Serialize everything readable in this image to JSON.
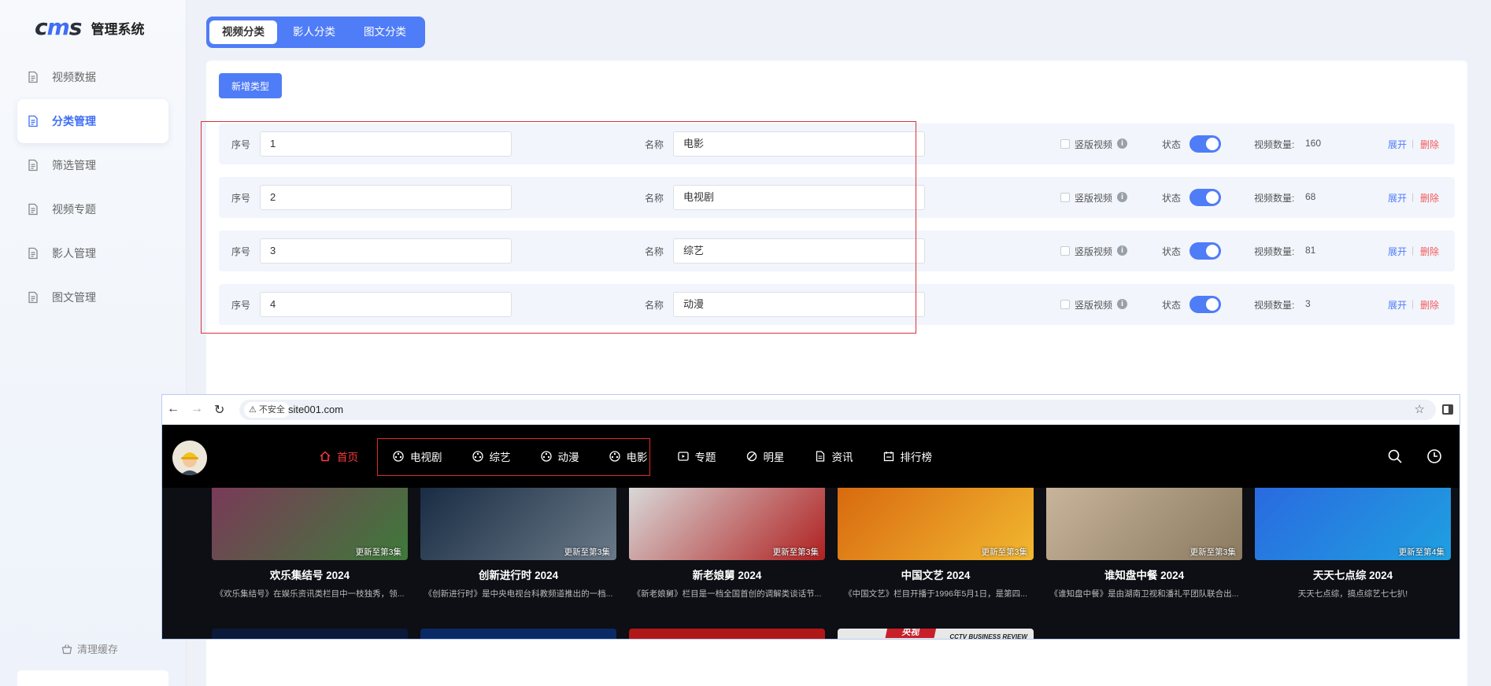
{
  "sidebar": {
    "logo": {
      "mark_left": "c",
      "mark_mid": "m",
      "mark_right": "s",
      "text": "管理系统"
    },
    "items": [
      {
        "label": "视频数据",
        "active": false
      },
      {
        "label": "分类管理",
        "active": true
      },
      {
        "label": "筛选管理",
        "active": false
      },
      {
        "label": "视频专题",
        "active": false
      },
      {
        "label": "影人管理",
        "active": false
      },
      {
        "label": "图文管理",
        "active": false
      }
    ],
    "clear_cache": "清理缓存"
  },
  "tabs": [
    {
      "label": "视频分类",
      "active": true
    },
    {
      "label": "影人分类",
      "active": false
    },
    {
      "label": "图文分类",
      "active": false
    }
  ],
  "toolbar": {
    "add_label": "新增类型"
  },
  "category_rows": [
    {
      "seq_label": "序号",
      "seq": "1",
      "name_label": "名称",
      "name": "电影",
      "vertical_label": "竖版视频",
      "status_label": "状态",
      "status_on": true,
      "count_label": "视频数量:",
      "count": "160",
      "expand": "展开",
      "delete": "删除"
    },
    {
      "seq_label": "序号",
      "seq": "2",
      "name_label": "名称",
      "name": "电视剧",
      "vertical_label": "竖版视频",
      "status_label": "状态",
      "status_on": true,
      "count_label": "视频数量:",
      "count": "68",
      "expand": "展开",
      "delete": "删除"
    },
    {
      "seq_label": "序号",
      "seq": "3",
      "name_label": "名称",
      "name": "综艺",
      "vertical_label": "竖版视频",
      "status_label": "状态",
      "status_on": true,
      "count_label": "视频数量:",
      "count": "81",
      "expand": "展开",
      "delete": "删除"
    },
    {
      "seq_label": "序号",
      "seq": "4",
      "name_label": "名称",
      "name": "动漫",
      "vertical_label": "竖版视频",
      "status_label": "状态",
      "status_on": true,
      "count_label": "视频数量:",
      "count": "3",
      "expand": "展开",
      "delete": "删除"
    }
  ],
  "browser": {
    "security": "不安全",
    "url": "site001.com",
    "nav": [
      {
        "label": "首页",
        "icon": "home-icon"
      },
      {
        "label": "电视剧",
        "icon": "film-reel-icon"
      },
      {
        "label": "综艺",
        "icon": "film-reel-icon"
      },
      {
        "label": "动漫",
        "icon": "film-reel-icon"
      },
      {
        "label": "电影",
        "icon": "film-reel-icon"
      },
      {
        "label": "专题",
        "icon": "play-box-icon"
      },
      {
        "label": "明星",
        "icon": "star-link-icon"
      },
      {
        "label": "资讯",
        "icon": "document-icon"
      },
      {
        "label": "排行榜",
        "icon": "calendar-icon"
      }
    ],
    "cards": [
      {
        "title": "欢乐集结号 2024",
        "update": "更新至第3集",
        "desc": "《欢乐集结号》在娱乐资讯类栏目中一枝独秀，领...",
        "color_a": "#7a3a58",
        "color_b": "#3e7a3a"
      },
      {
        "title": "创新进行时 2024",
        "update": "更新至第3集",
        "desc": "《创新进行时》是中央电视台科教频道推出的一档...",
        "color_a": "#1a2c44",
        "color_b": "#6a7a88"
      },
      {
        "title": "新老娘舅 2024",
        "update": "更新至第3集",
        "desc": "《新老娘舅》栏目是一档全国首创的调解类谈话节...",
        "color_a": "#d8d8d8",
        "color_b": "#b02020"
      },
      {
        "title": "中国文艺 2024",
        "update": "更新至第3集",
        "desc": "《中国文艺》栏目开播于1996年5月1日，是第四...",
        "color_a": "#d86a10",
        "color_b": "#f2b830"
      },
      {
        "title": "谁知盘中餐 2024",
        "update": "更新至第3集",
        "desc": "《谁知盘中餐》是由湖南卫视和潘礼平团队联合出...",
        "color_a": "#c8b49a",
        "color_b": "#8a7a60"
      },
      {
        "title": "天天七点综 2024",
        "update": "更新至第4集",
        "desc": "天天七点综，搞点综艺七七扒!",
        "color_a": "#2a6ae0",
        "color_b": "#1fa0e0"
      }
    ],
    "row2": [
      {
        "color": "#0b1a3a"
      },
      {
        "color": "#0a2a66"
      },
      {
        "color": "#b01818"
      },
      {
        "color": "#e8e8e8",
        "badge": "央视",
        "caption": "CCTV BUSINESS REVIEW"
      }
    ]
  }
}
